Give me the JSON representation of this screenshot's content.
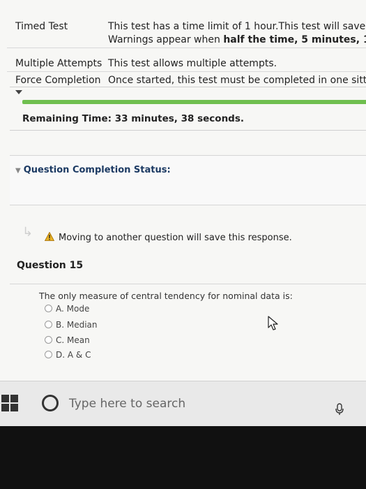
{
  "test_info": {
    "rows": [
      {
        "label": "Timed Test",
        "value": "This test has a time limit of 1 hour.This test will save",
        "value_line2_prefix": "Warnings appear when ",
        "value_line2_bold": "half the time, 5 minutes, 1"
      },
      {
        "label": "Multiple Attempts",
        "value": "This test allows multiple attempts."
      },
      {
        "label": "Force Completion",
        "value": "Once started, this test must be completed in one sitt"
      }
    ]
  },
  "timer": {
    "remaining_label": "Remaining Time:",
    "remaining_value": "33 minutes, 38 seconds.",
    "progress_color": "#6fbf4f"
  },
  "status": {
    "label": "Question Completion Status:"
  },
  "warning": {
    "text": "Moving to another question will save this response."
  },
  "question": {
    "title": "Question 15",
    "prompt": "The only measure of central tendency for nominal data is:",
    "options": [
      "A. Mode",
      "B. Median",
      "C. Mean",
      "D. A & C"
    ]
  },
  "taskbar": {
    "search_placeholder": "Type here to search"
  },
  "icons": {
    "windows": "windows-logo-icon",
    "search": "search-circle-icon",
    "mic": "microphone-icon",
    "warning": "warning-triangle-icon",
    "cursor": "mouse-cursor-icon"
  }
}
